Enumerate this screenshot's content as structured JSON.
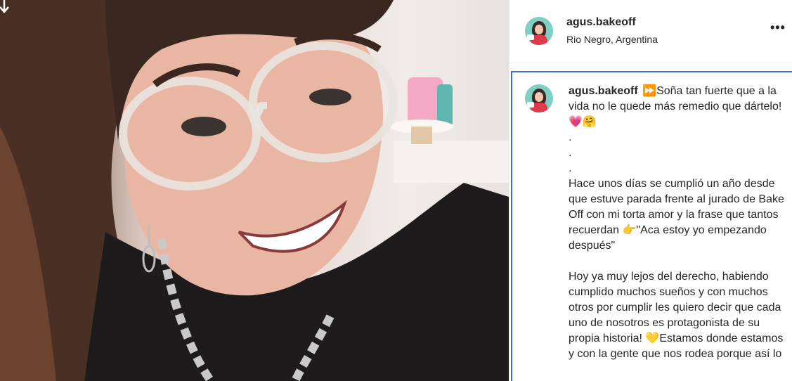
{
  "post": {
    "author": "agus.bakeoff",
    "location": "Rio Negro, Argentina",
    "more_icon": "more-options-icon",
    "download_icon": "arrow-down-icon"
  },
  "caption": {
    "username": "agus.bakeoff",
    "text": "⏩Soña tan fuerte que a la vida no le quede más remedio que dártelo!💗🤗\n.\n.\n.\nHace unos días se cumplió un año desde que estuve parada frente al jurado de Bake Off con mi torta amor y la frase que tantos recuerdan 👉\"Aca estoy yo empezando después\"\n\nHoy ya muy lejos del derecho, habiendo cumplido muchos sueños y con muchos otros por cumplir les quiero decir que cada uno de nosotros es protagonista de su propia historia! 💛Estamos donde estamos y con la gente que nos rodea porque así lo"
  },
  "colors": {
    "focus_outline": "#3f6ad8",
    "divider": "#efefef"
  }
}
